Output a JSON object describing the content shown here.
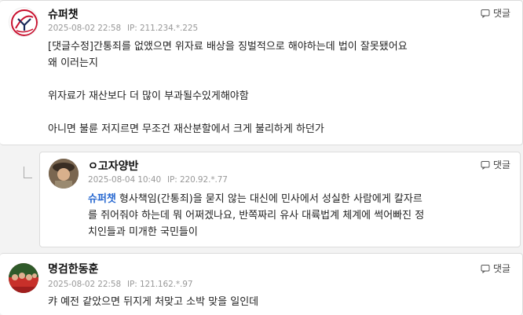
{
  "reply_label": "댓글",
  "comments": [
    {
      "nickname": "슈퍼챗",
      "date": "2025-08-02 22:58",
      "ip_label": "IP:",
      "ip": "211.234.*.225",
      "lines": [
        "[댓글수정]간통죄를 없앴으면 위자료 배상을 징벌적으로 해야하는데 법이 잘못됐어요",
        "왜 이러는지",
        "",
        "위자료가 재산보다 더 많이 부과될수있게해야함",
        "",
        "아니면 불륜 저지르면 무조건 재산분할에서 크게 불리하게 하던가"
      ]
    },
    {
      "nickname": "ㅇ고자양반",
      "date": "2025-08-04 10:40",
      "ip_label": "IP:",
      "ip": "220.92.*.77",
      "mention": "슈퍼챗",
      "lines": [
        "형사책임(간통죄)을 묻지 않는 대신에 민사에서 성실한 사람에게 칼자르",
        "를 쥐어줘야 하는데 뭐 어쩌겠나요, 반쪽짜리 유사 대륙법계 체계에 썩어빠진 정",
        "치인들과 미개한 국민들이"
      ]
    },
    {
      "nickname": "명검한동훈",
      "date": "2025-08-02 22:58",
      "ip_label": "IP:",
      "ip": "121.162.*.97",
      "lines": [
        "캬 예전 같았으면 뒤지게 처맞고 소박 맞을 일인데"
      ]
    }
  ]
}
